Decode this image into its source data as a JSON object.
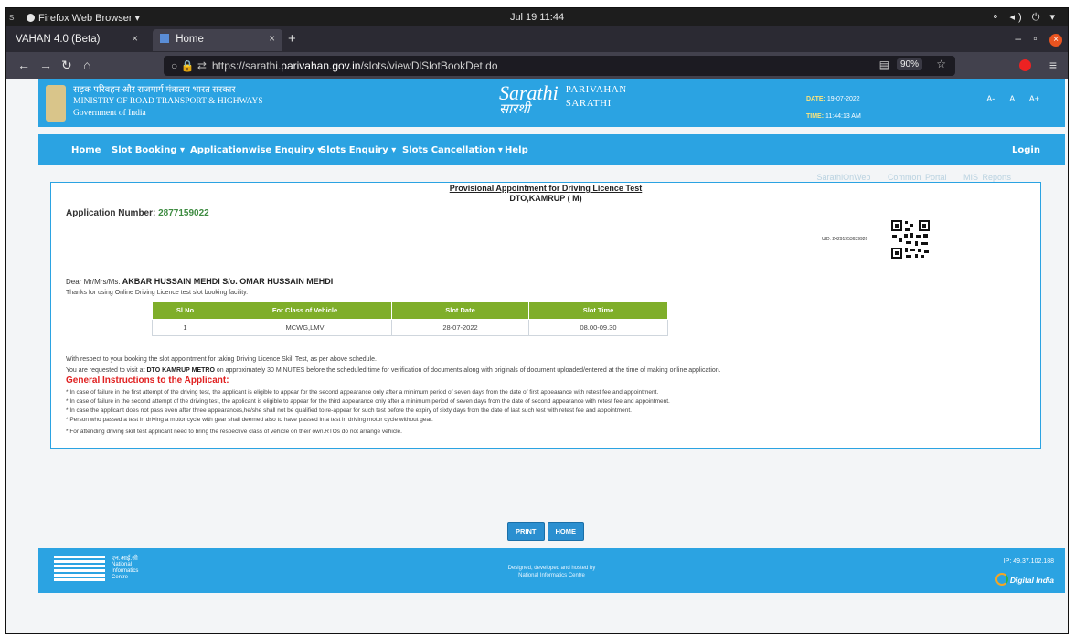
{
  "os": {
    "app_label": "Firefox Web Browser ▾",
    "clock": "Jul 19  11:44",
    "left_fragment": "s",
    "tray": "⚬ ◂) ⏻ ▾"
  },
  "browser": {
    "tabs": [
      {
        "label": "VAHAN 4.0 (Beta)",
        "close": "×"
      },
      {
        "label": "Home",
        "close": "×"
      }
    ],
    "new_tab": "+",
    "win": {
      "min": "–",
      "max": "▫",
      "close": "×"
    },
    "nav": {
      "back": "←",
      "forward": "→",
      "reload": "↻",
      "home": "⌂"
    },
    "url_prefix": "https://sarathi.",
    "url_domain": "parivahan.gov.in",
    "url_path": "/slots/viewDlSlotBookDet.do",
    "url_icons": "○ 🔒 ⇄",
    "reader": "▤",
    "zoom": "90%",
    "star": "☆",
    "menu": "≡"
  },
  "site": {
    "ministry_hindi": "सड़क परिवहन और राजमार्ग मंत्रालय भारत सरकार",
    "ministry_en": "MINISTRY OF ROAD TRANSPORT & HIGHWAYS",
    "gov": "Government of India",
    "logo_script": "Sarathi",
    "logo_hindi": "सारथी",
    "logo_top": "PARIVAHAN",
    "logo_bottom": "SARATHI",
    "date_label": "DATE:",
    "date_value": "19-07-2022",
    "time_label": "TIME:",
    "time_value": "11:44:13 AM",
    "font_sizes": "A- A A+"
  },
  "menu": {
    "items": [
      "Home",
      "Slot Booking ▾",
      "Applicationwise Enquiry ▾",
      "Slots Enquiry ▾",
      "Slots Cancellation ▾",
      "Help"
    ],
    "login": "Login"
  },
  "top_links": [
    "SarathiOnWeb",
    "Common Portal",
    "MIS Reports"
  ],
  "appointment": {
    "title": "Provisional Appointment for Driving Licence Test",
    "office": "DTO,KAMRUP ( M)",
    "app_no_label": "Application Number:",
    "app_no": "2877159022",
    "uid": "UID: 24291953639926",
    "dear_prefix": "Dear Mr/Mrs/Ms.",
    "name": "AKBAR HUSSAIN MEHDI S/o. OMAR HUSSAIN MEHDI",
    "thanks": "Thanks for using Online Driving Licence test slot booking facility.",
    "table": {
      "headers": [
        "Sl No",
        "For Class of Vehicle",
        "Slot Date",
        "Slot Time"
      ],
      "rows": [
        [
          "1",
          "MCWG,LMV",
          "28-07-2022",
          "08.00-09.30"
        ]
      ]
    },
    "respect": "With respect to your booking the slot appointment for taking Driving Licence Skill Test, as per above schedule.",
    "visit_pre": "You are requested to visit at",
    "visit_place": "DTO KAMRUP METRO",
    "visit_post": "on approximately 30 MINUTES before the scheduled time for verification of documents along with originals of document uploaded/entered at the time of making online application.",
    "gi_title": "General Instructions to the Applicant:",
    "instructions": [
      "* In case of failure in the first attempt of the driving test, the applicant is eligible to appear for the second appearance only after a minimum period of seven days from the date of first appearance with retest fee and appointment.",
      "* In case of failure in the second attempt of the driving test, the applicant is eligible to appear for the third appearance only after a minimum period of seven days from the date of second appearance with retest fee and appointment.",
      "* In case the applicant does not pass even after three appearances,he/she shall not be qualified to re-appear for such test before the expiry of sixty days from the date of last such test with retest fee and appointment.",
      "* Person who passed a test in driving a motor cycle with gear shall deemed also to have passed in a test in driving motor cycle without gear."
    ],
    "last_instruction": "* For attending driving skill test applicant need to bring the respective class of vehicle on their own.RTOs do not arrange vehicle."
  },
  "buttons": {
    "print": "PRINT",
    "home": "HOME"
  },
  "footer": {
    "nic_hindi": "एन.आई.सी",
    "nic_lines": [
      "National",
      "Informatics",
      "Centre"
    ],
    "credit1": "Designed, developed and hosted by",
    "credit2": "National Informatics Centre",
    "ip": "IP: 49.37.102.188",
    "digital": "Digital India"
  },
  "colors": {
    "accent": "#2ba3e2",
    "table_header": "#7fae2a",
    "warning": "#e02020",
    "app_no": "#3d8b40"
  }
}
